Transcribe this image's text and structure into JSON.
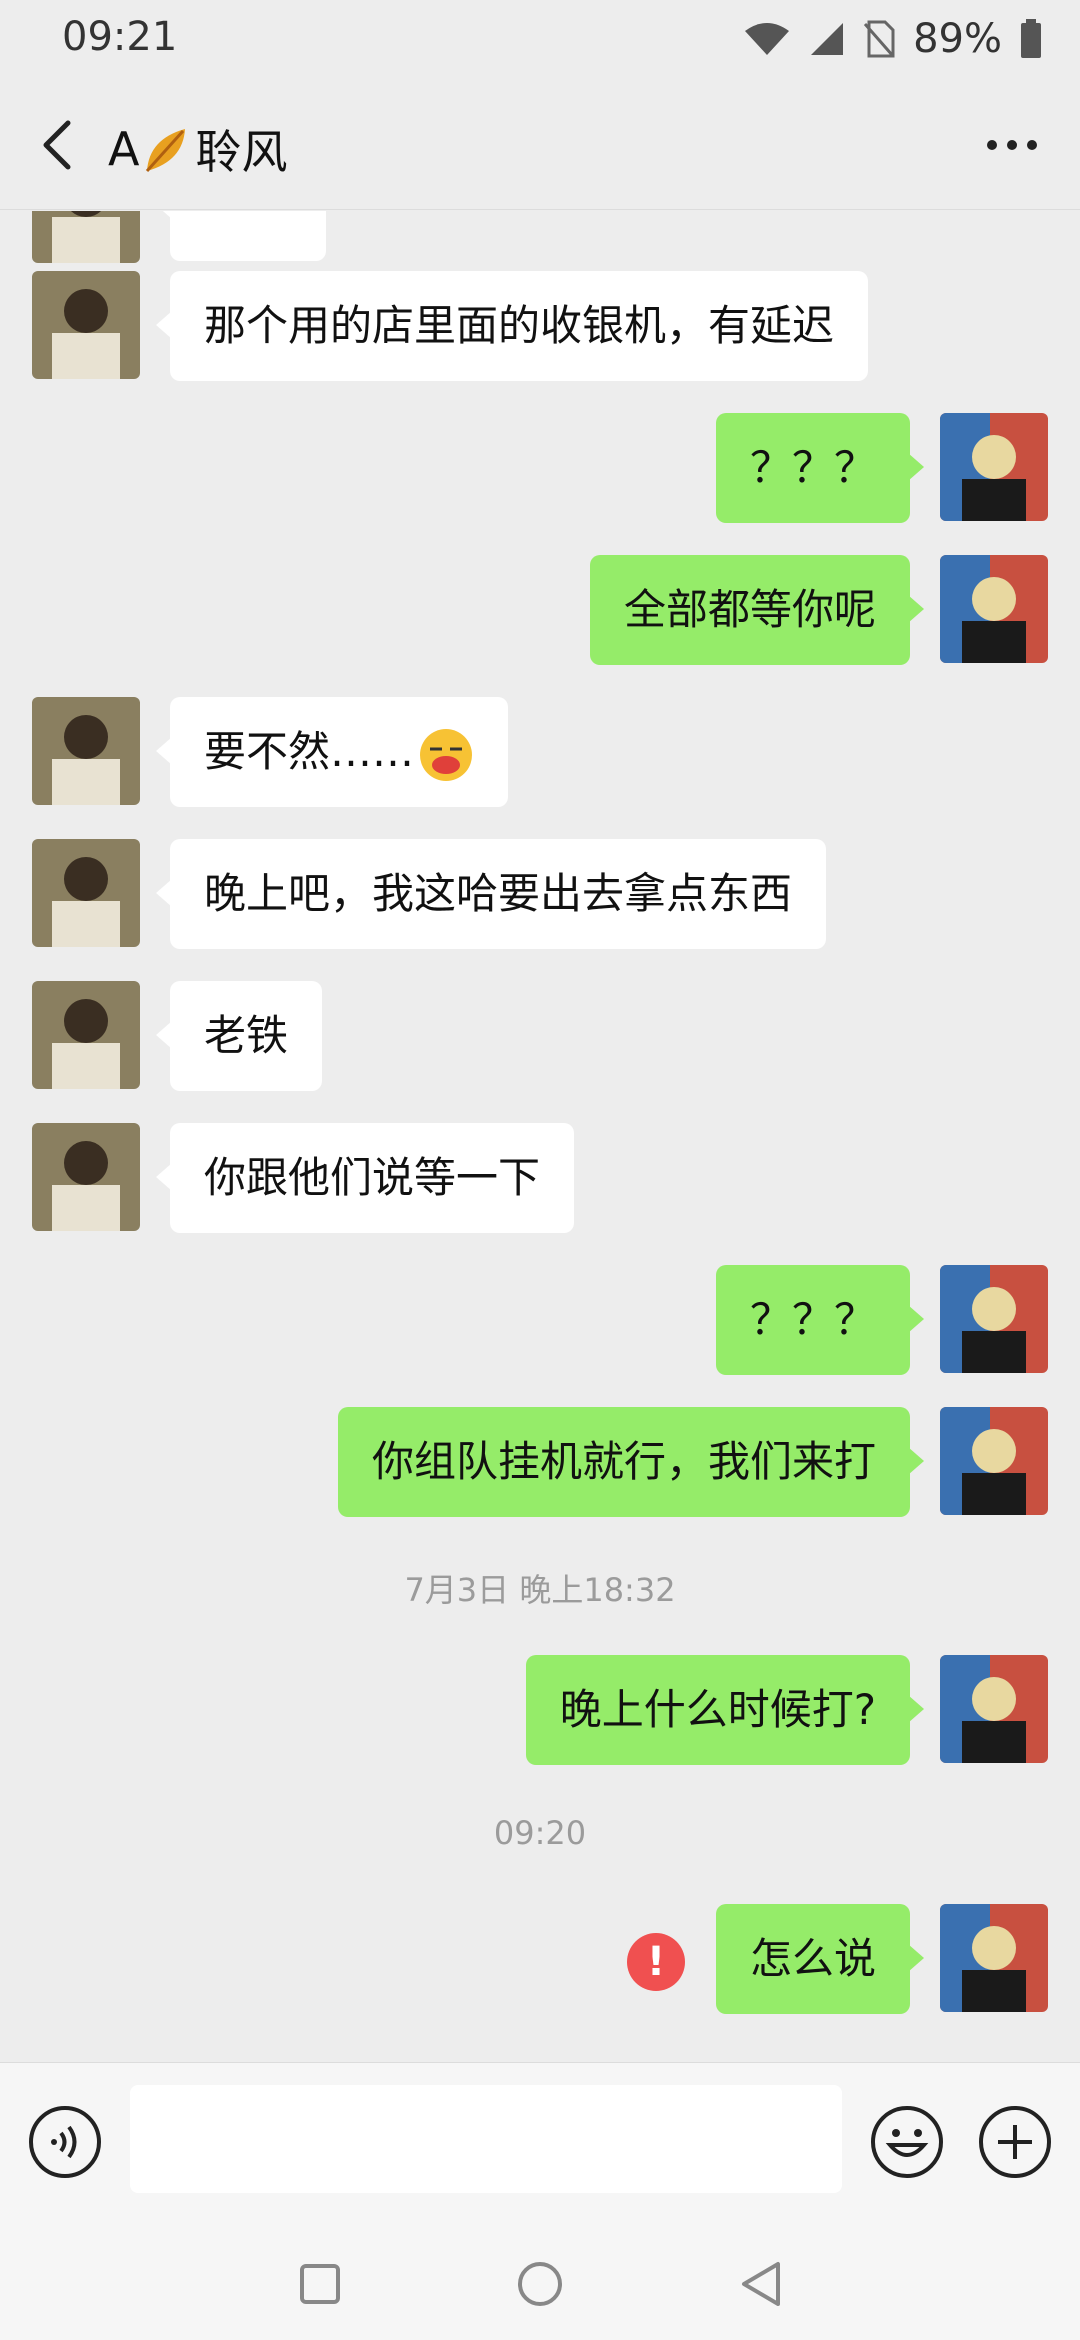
{
  "status_bar": {
    "time": "09:21",
    "battery": "89%"
  },
  "header": {
    "title_prefix": "A",
    "title_name": "聆风"
  },
  "messages": {
    "m0": "",
    "m1": "那个用的店里面的收银机，有延迟",
    "m2": "？？？",
    "m3": "全部都等你呢",
    "m4": "要不然……",
    "m5": "晚上吧，我这哈要出去拿点东西",
    "m6": "老铁",
    "m7": "你跟他们说等一下",
    "m8": "？？？",
    "m9": "你组队挂机就行，我们来打",
    "ts1": "7月3日 晚上18:32",
    "m10": "晚上什么时候打?",
    "ts2": "09:20",
    "m11": "怎么说",
    "error_mark": "!"
  },
  "input": {
    "value": "",
    "placeholder": ""
  },
  "icons": {
    "back": "chevron-left-icon",
    "more": "more-dots-icon",
    "voice": "voice-icon",
    "emoji": "emoji-icon",
    "plus": "plus-icon",
    "leaf": "leaf-icon",
    "wifi": "wifi-icon",
    "signal": "signal-icon",
    "no_sim": "no-sim-icon",
    "battery": "battery-icon"
  },
  "colors": {
    "background": "#ededed",
    "incoming_bubble": "#ffffff",
    "outgoing_bubble": "#95ec69",
    "error": "#f05050"
  }
}
